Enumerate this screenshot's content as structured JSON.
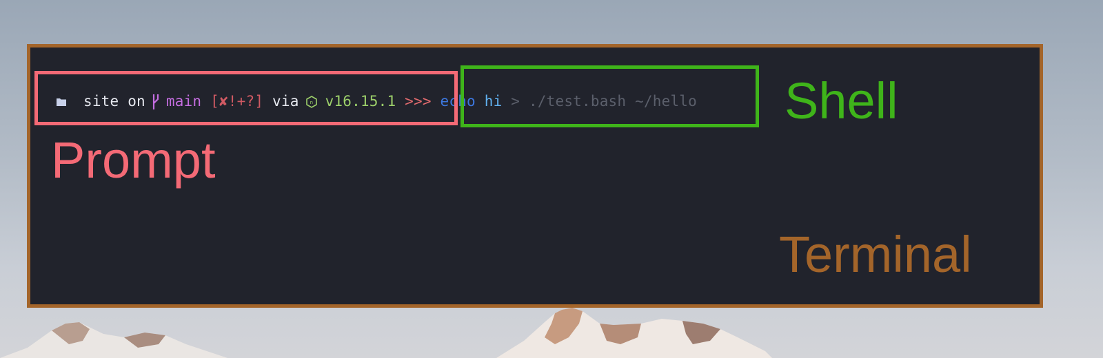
{
  "terminal": {
    "prompt": {
      "directory": "site",
      "on_text": "on",
      "branch": "main",
      "git_status": "[✘!+?]",
      "via_text": "via",
      "node_version": "v16.15.1",
      "prompt_symbol": ">>>"
    },
    "command": {
      "cmd": "echo",
      "arg": "hi",
      "redirect": ">",
      "path1": "./test.bash",
      "path2": "~/hello"
    }
  },
  "labels": {
    "shell": "Shell",
    "prompt": "Prompt",
    "terminal": "Terminal"
  },
  "colors": {
    "terminal_bg": "#21232c",
    "terminal_border": "#a4652a",
    "prompt_highlight": "#f46a76",
    "shell_highlight": "#3fb41a",
    "text_white": "#e6e8ef",
    "branch_purple": "#c46de0",
    "git_status_red": "#d05a63",
    "node_green": "#9ccf6a",
    "prompt_symbol_red": "#e26b6e",
    "cmd_blue": "#3d78e0",
    "arg_cyan": "#61b1f0",
    "dim_gray": "#5b5f6b"
  },
  "icons": [
    "folder-icon",
    "git-branch-icon",
    "nodejs-icon"
  ]
}
